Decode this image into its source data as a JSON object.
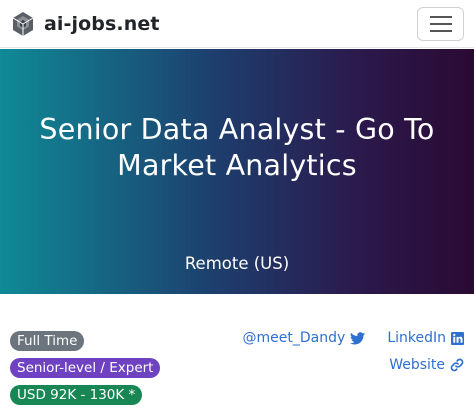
{
  "navbar": {
    "brand": "ai-jobs.net",
    "logo_icon": "honeycomb-logo-icon",
    "menu_icon": "hamburger-menu-icon"
  },
  "hero": {
    "title": "Senior Data Analyst - Go To Market Analytics",
    "location": "Remote (US)",
    "gradient_colors": [
      "#0f8a96",
      "#1d3f6e",
      "#2b1a4d",
      "#2a0a33"
    ]
  },
  "badges": {
    "employment_type": "Full Time",
    "level": "Senior-level / Expert",
    "salary": "USD 92K - 130K *",
    "colors": {
      "employment_type": "#6c757d",
      "level": "#6f42c1",
      "salary": "#198754"
    }
  },
  "links": {
    "twitter": {
      "label": "@meet_Dandy",
      "icon": "twitter-bird-icon"
    },
    "linkedin": {
      "label": "LinkedIn",
      "icon": "linkedin-icon"
    },
    "website": {
      "label": "Website",
      "icon": "link-icon"
    },
    "color": "#2e6fd0"
  }
}
